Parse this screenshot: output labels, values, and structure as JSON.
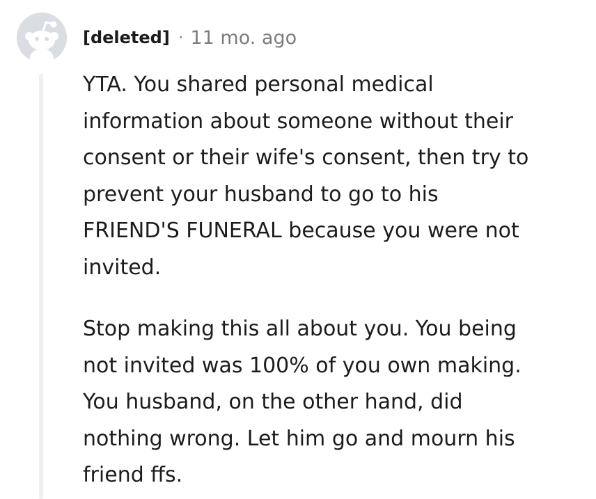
{
  "comment": {
    "author": "[deleted]",
    "separator": "·",
    "timestamp": "11 mo. ago",
    "avatar_icon": "reddit-snoo-icon",
    "paragraphs": [
      "YTA. You shared personal medical\ninformation about someone without their\nconsent or their wife's consent, then try to\nprevent your husband to go to his\nFRIEND'S FUNERAL because you were not\ninvited.",
      "Stop making this all about you. You being\nnot invited was 100% of you own making.\nYou husband, on the other hand, did\nnothing wrong. Let him go and mourn his\nfriend ffs."
    ]
  }
}
